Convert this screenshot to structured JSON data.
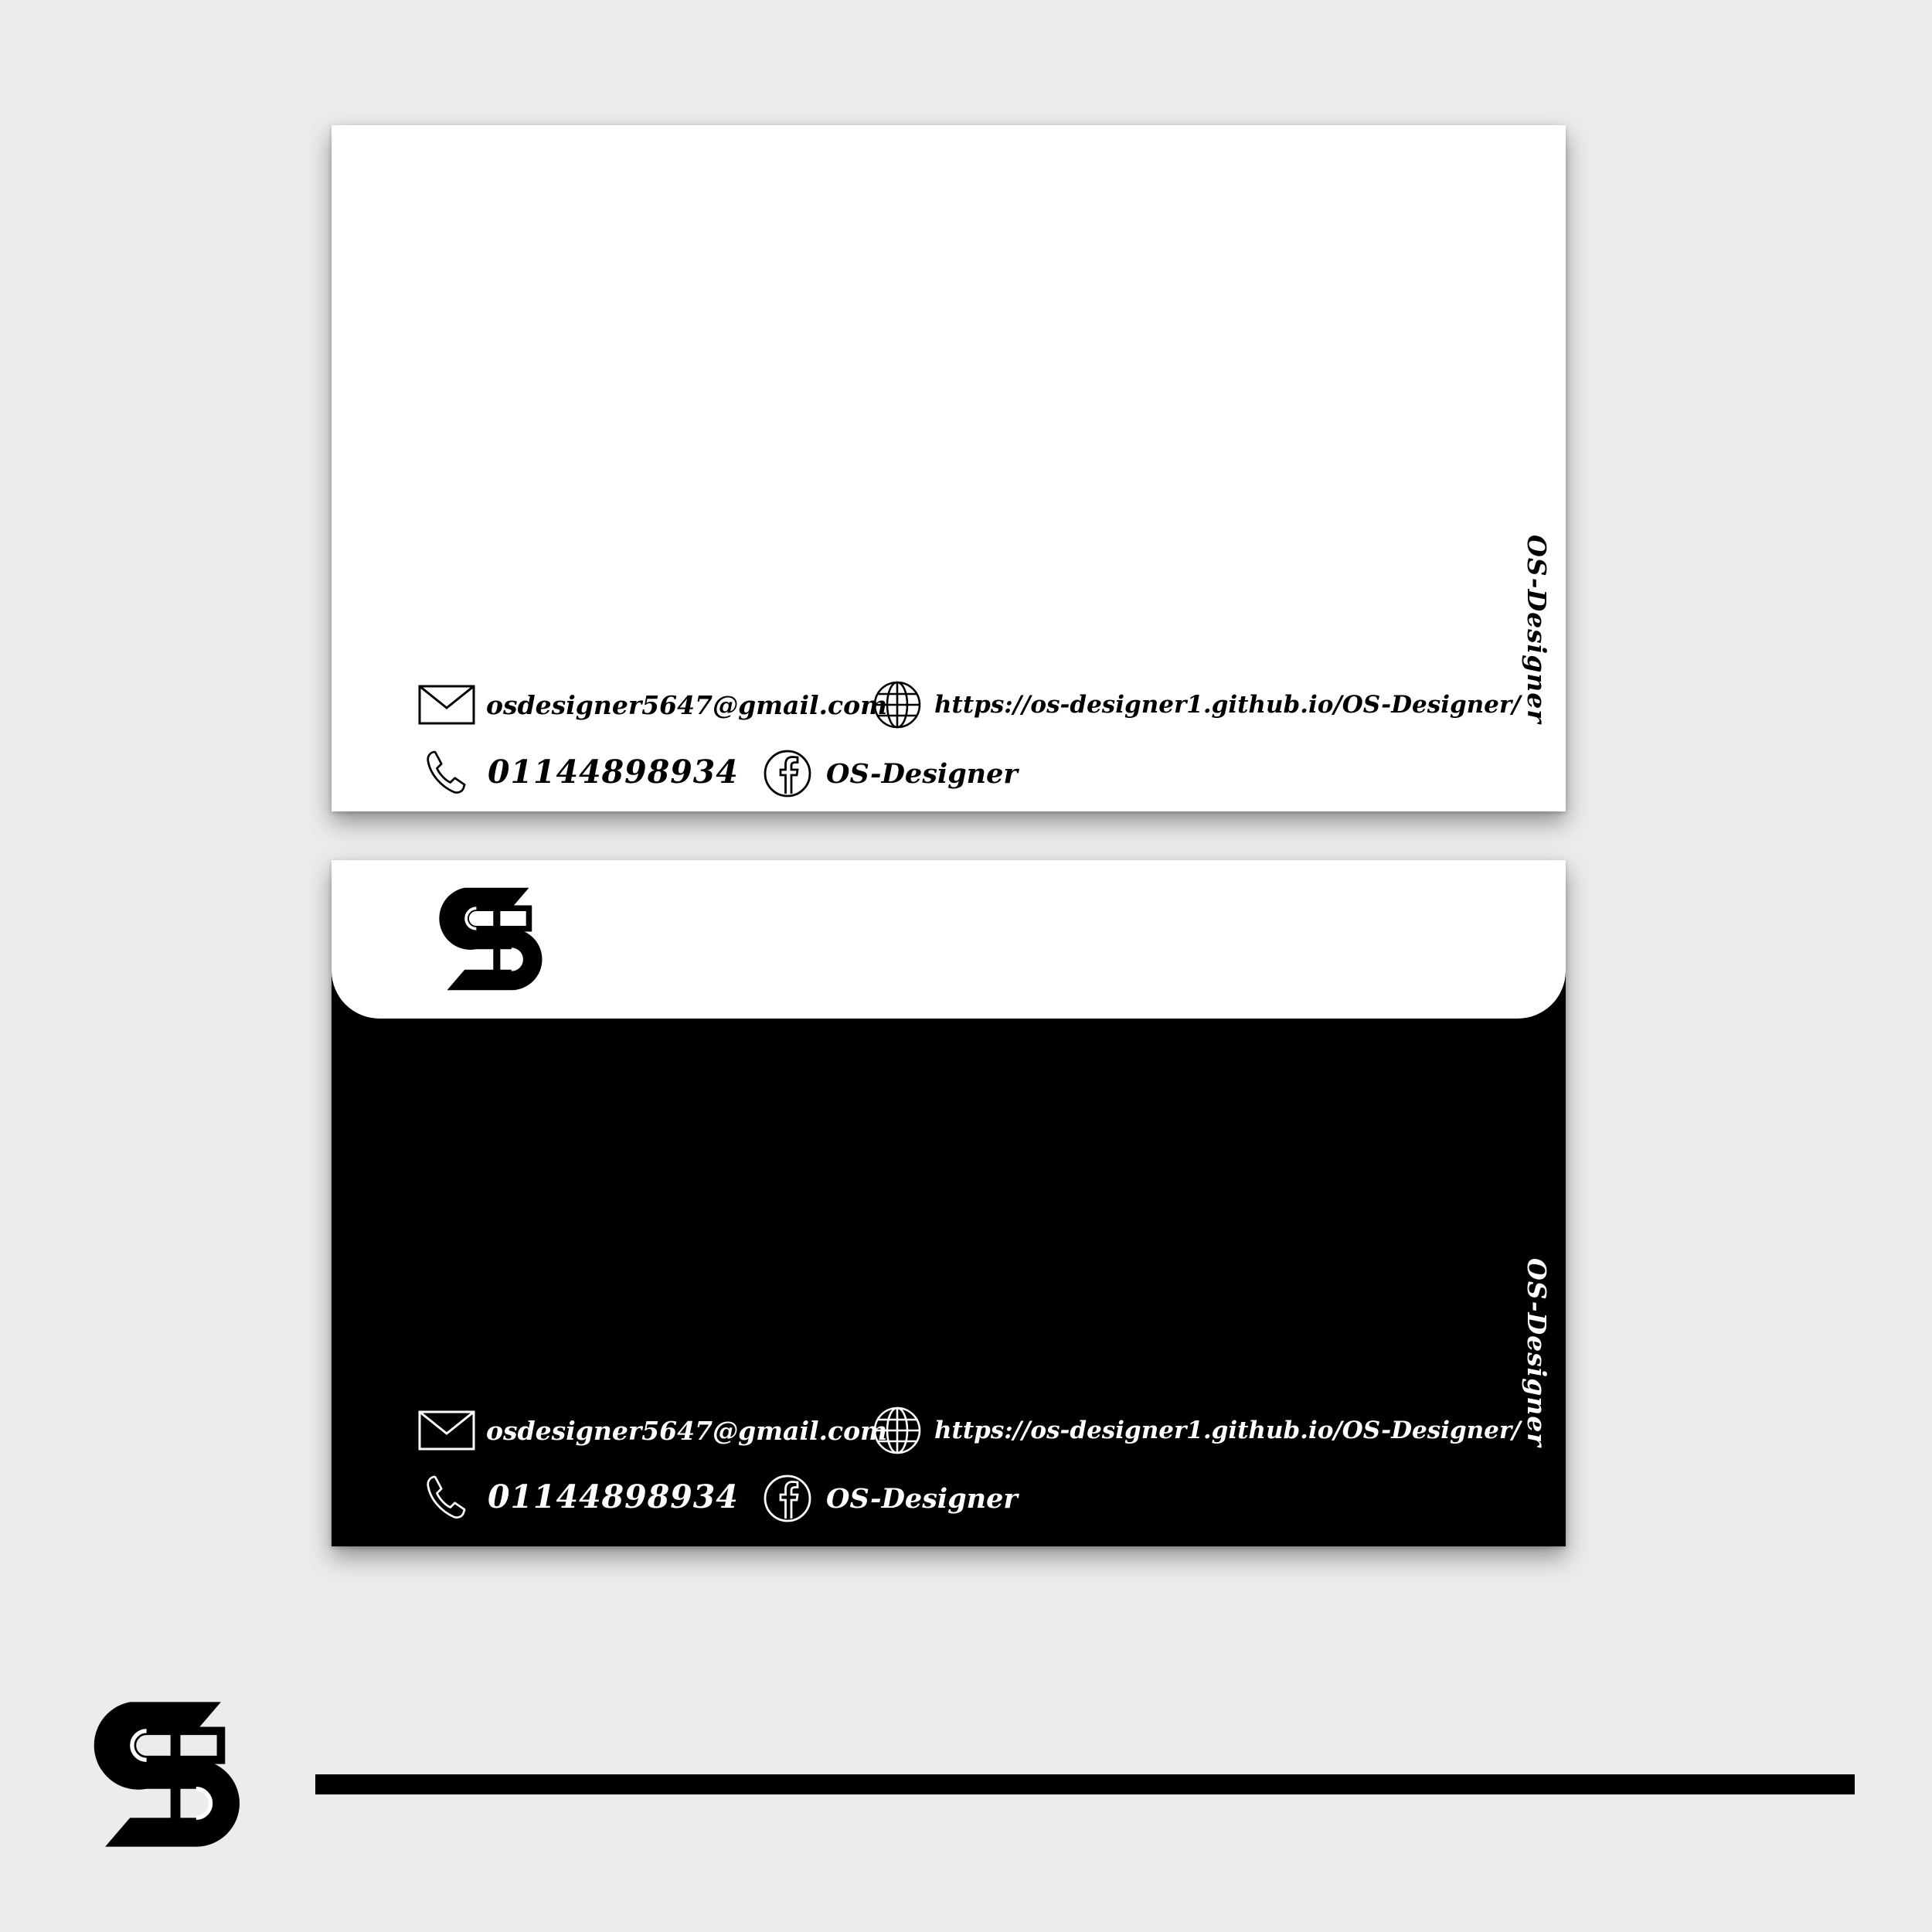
{
  "brand": {
    "name": "OS-Designer",
    "logo_letters": "OS"
  },
  "contact": {
    "email": "osdesigner5647@gmail.com",
    "website": "https://os-designer1.github.io/OS-Designer/",
    "phone": "01144898934",
    "facebook": "OS-Designer"
  },
  "icons": [
    "envelope-icon",
    "globe-icon",
    "phone-icon",
    "facebook-icon"
  ],
  "colors": {
    "background": "#ececec",
    "card_light": "#ffffff",
    "card_dark": "#000000"
  }
}
